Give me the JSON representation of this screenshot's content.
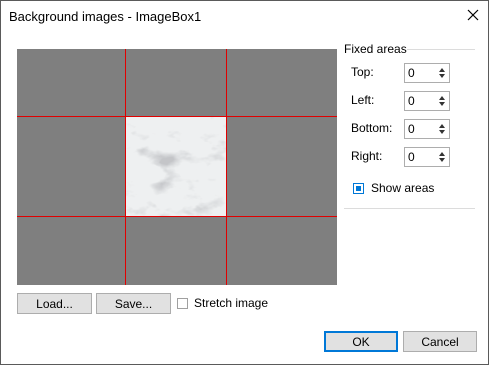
{
  "window": {
    "title": "Background images - ImageBox1",
    "close_icon": "close-icon"
  },
  "preview": {
    "background_color": "#7f7f7f",
    "line_color": "#e00000",
    "tile_image": "marble-texture"
  },
  "buttons": {
    "load_label": "Load...",
    "save_label": "Save...",
    "ok_label": "OK",
    "cancel_label": "Cancel"
  },
  "stretch": {
    "label": "Stretch image",
    "checked": false
  },
  "fixed_areas": {
    "group_label": "Fixed areas",
    "fields": [
      {
        "label": "Top:",
        "value": "0"
      },
      {
        "label": "Left:",
        "value": "0"
      },
      {
        "label": "Bottom:",
        "value": "0"
      },
      {
        "label": "Right:",
        "value": "0"
      }
    ],
    "show_areas": {
      "label": "Show areas",
      "checked": true
    }
  },
  "colors": {
    "accent": "#0078d7",
    "button_face": "#e1e1e1"
  }
}
